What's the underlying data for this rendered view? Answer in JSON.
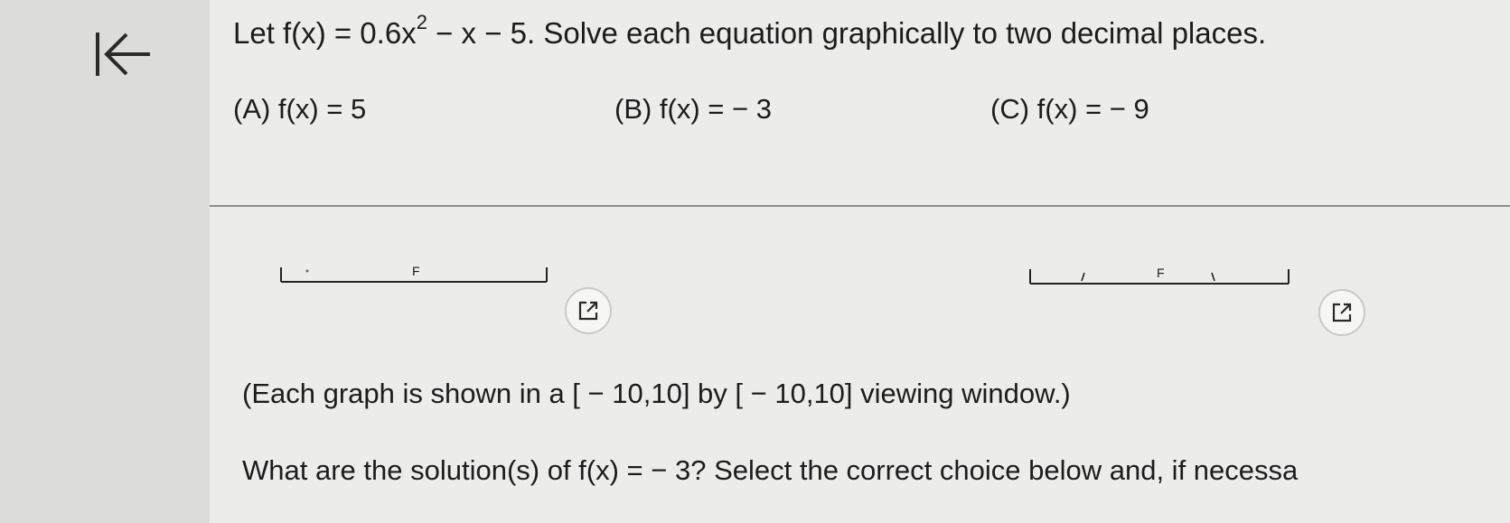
{
  "question": {
    "stem_prefix": "Let f(x) = 0.6x",
    "stem_exponent": "2",
    "stem_suffix": " − x − 5. Solve each equation graphically to two decimal places.",
    "options": [
      {
        "label": "(A) f(x) = 5"
      },
      {
        "label": "(B) f(x) = − 3"
      },
      {
        "label": "(C) f(x) = − 9"
      }
    ]
  },
  "graphs": {
    "left_label": "F",
    "right_label": "F"
  },
  "note": "(Each graph is shown in a [ − 10,10] by [ − 10,10] viewing window.)",
  "prompt": "What are the solution(s) of f(x) = − 3? Select the correct choice below and, if necessa",
  "icons": {
    "back": "collapse-left-icon",
    "enlarge": "external-link-icon"
  },
  "colors": {
    "page_bg": "#ececea",
    "panel_bg": "#dcdcda",
    "text": "#1c1c1e"
  }
}
